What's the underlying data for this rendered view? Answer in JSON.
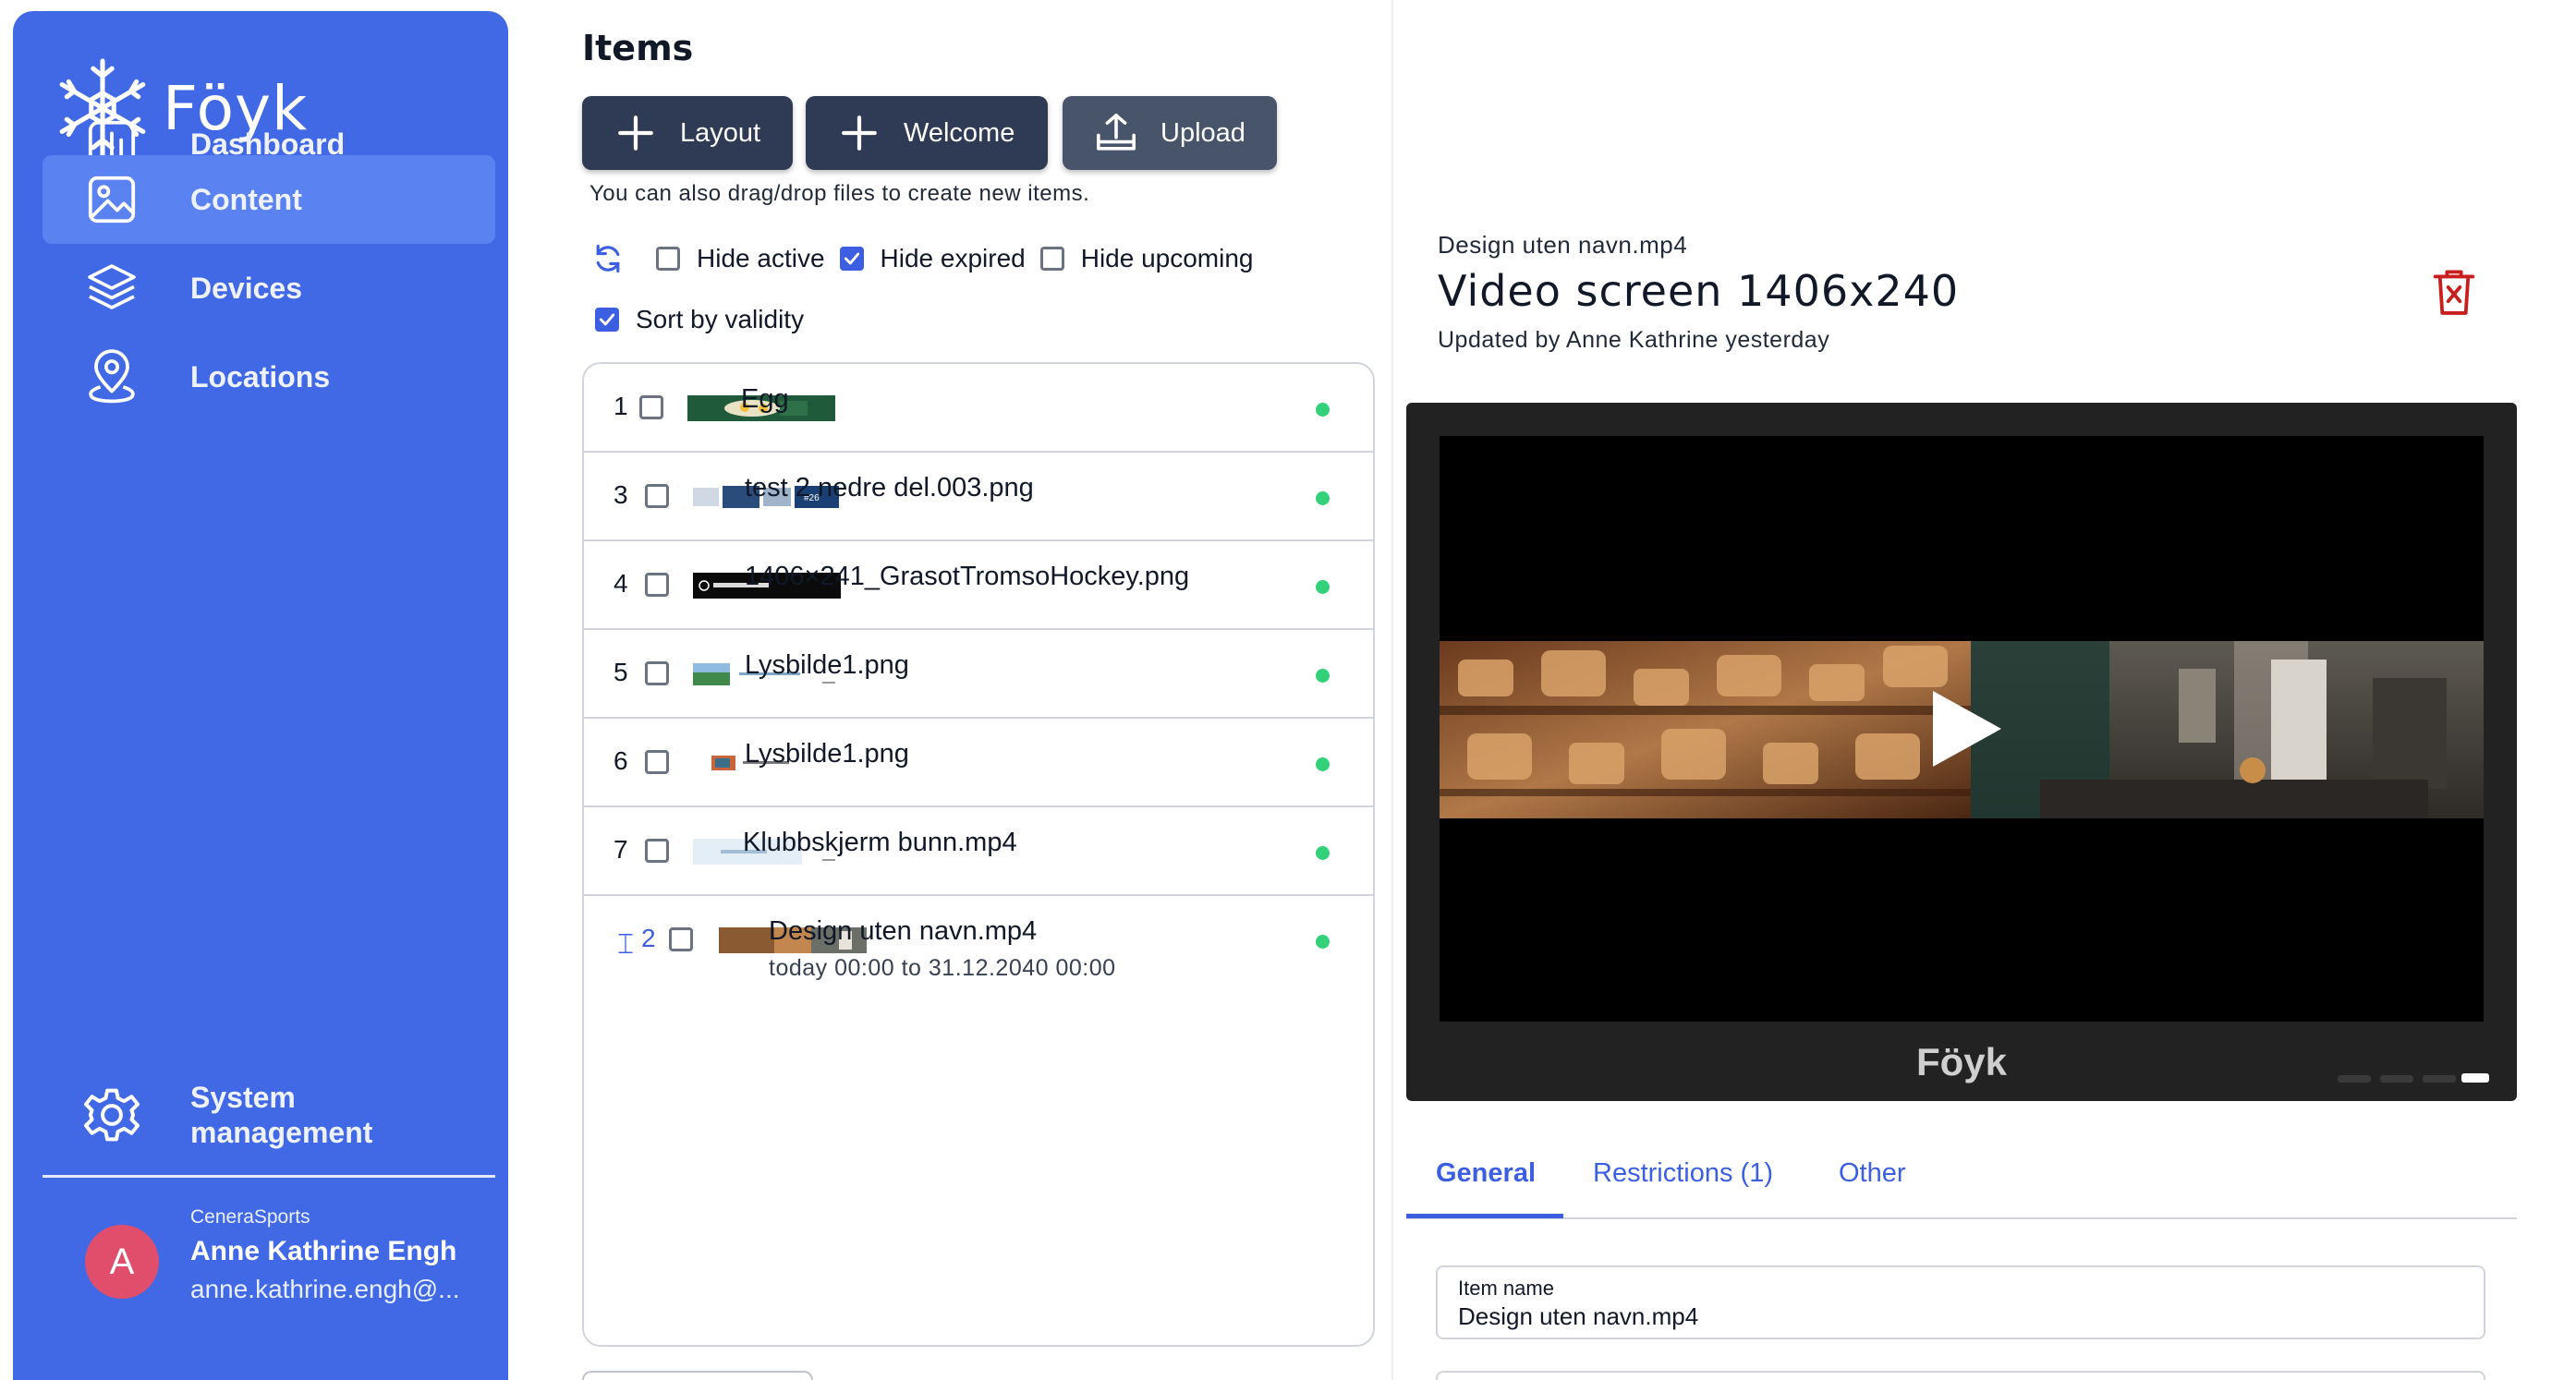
{
  "app": {
    "name": "Föyk"
  },
  "sidebar": {
    "items": [
      {
        "label": "Dashboard",
        "icon": "chart-icon"
      },
      {
        "label": "Content",
        "icon": "image-icon",
        "active": true
      },
      {
        "label": "Devices",
        "icon": "layers-icon"
      },
      {
        "label": "Locations",
        "icon": "location-pin-icon"
      }
    ],
    "system": {
      "label_line1": "System",
      "label_line2": "management",
      "icon": "gear-icon"
    },
    "user": {
      "org": "CeneraSports",
      "name": "Anne Kathrine Engh",
      "email": "anne.kathrine.engh@...",
      "initial": "A"
    }
  },
  "items_panel": {
    "title": "Items",
    "buttons": {
      "layout": "Layout",
      "welcome": "Welcome",
      "upload": "Upload"
    },
    "hint": "You can also drag/drop files to create new items.",
    "filters": {
      "hide_active": {
        "label": "Hide active",
        "checked": false
      },
      "hide_expired": {
        "label": "Hide expired",
        "checked": true
      },
      "hide_upcoming": {
        "label": "Hide upcoming",
        "checked": false
      },
      "sort_by_validity": {
        "label": "Sort by validity",
        "checked": true
      }
    },
    "rows": [
      {
        "num": "1",
        "name": "Egg",
        "status": "active"
      },
      {
        "num": "3",
        "name": "test 2 nedre del.003.png",
        "status": "active"
      },
      {
        "num": "4",
        "name": "1406×241_GrasotTromsoHockey.png",
        "status": "active"
      },
      {
        "num": "5",
        "name": "Lysbilde1.png",
        "status": "active"
      },
      {
        "num": "6",
        "name": "Lysbilde1.png",
        "status": "active"
      },
      {
        "num": "7",
        "name": "Klubbskjerm bunn.mp4",
        "status": "active"
      },
      {
        "num": "2",
        "name": "Design uten navn.mp4",
        "validity": "today 00:00 to 31.12.2040 00:00",
        "status": "active"
      }
    ]
  },
  "detail": {
    "filename": "Design uten navn.mp4",
    "title": "Video screen 1406x240",
    "updated": "Updated by Anne Kathrine yesterday",
    "screen_brand": "Föyk",
    "tabs": [
      {
        "label": "General",
        "active": true
      },
      {
        "label": "Restrictions (1)"
      },
      {
        "label": "Other"
      }
    ],
    "fields": {
      "item_name": {
        "label": "Item name",
        "value": "Design uten navn.mp4"
      }
    }
  },
  "colors": {
    "sidebar": "#4169e6",
    "accent": "#3b5fe0",
    "button": "#2f3b55",
    "status_active": "#34d07a",
    "danger": "#c81e1e"
  }
}
